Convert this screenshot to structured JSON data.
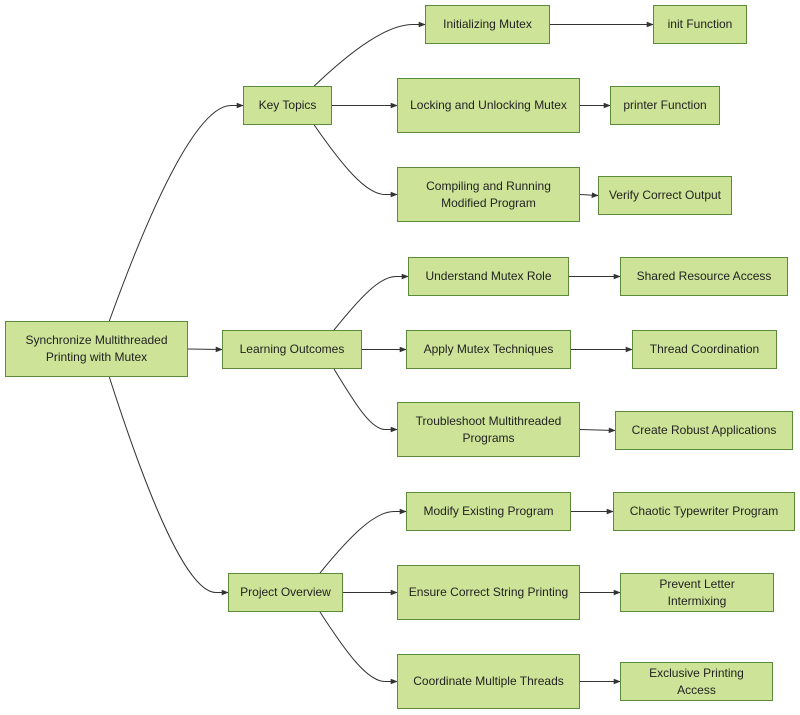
{
  "diagram": {
    "title": "Synchronize Multithreaded Printing with Mutex",
    "colors": {
      "node_fill": "#cde498",
      "node_border": "#5b8a3a",
      "edge": "#333333"
    },
    "nodes": [
      {
        "id": "root",
        "label": "Synchronize Multithreaded Printing with Mutex"
      },
      {
        "id": "kt",
        "label": "Key Topics"
      },
      {
        "id": "lo",
        "label": "Learning Outcomes"
      },
      {
        "id": "po",
        "label": "Project Overview"
      },
      {
        "id": "kt1",
        "label": "Initializing Mutex"
      },
      {
        "id": "kt2",
        "label": "Locking and Unlocking Mutex"
      },
      {
        "id": "kt3",
        "label": "Compiling and Running Modified Program"
      },
      {
        "id": "kt1a",
        "label": "init Function"
      },
      {
        "id": "kt2a",
        "label": "printer Function"
      },
      {
        "id": "kt3a",
        "label": "Verify Correct Output"
      },
      {
        "id": "lo1",
        "label": "Understand Mutex Role"
      },
      {
        "id": "lo2",
        "label": "Apply Mutex Techniques"
      },
      {
        "id": "lo3",
        "label": "Troubleshoot Multithreaded Programs"
      },
      {
        "id": "lo1a",
        "label": "Shared Resource Access"
      },
      {
        "id": "lo2a",
        "label": "Thread Coordination"
      },
      {
        "id": "lo3a",
        "label": "Create Robust Applications"
      },
      {
        "id": "po1",
        "label": "Modify Existing Program"
      },
      {
        "id": "po2",
        "label": "Ensure Correct String Printing"
      },
      {
        "id": "po3",
        "label": "Coordinate Multiple Threads"
      },
      {
        "id": "po1a",
        "label": "Chaotic Typewriter Program"
      },
      {
        "id": "po2a",
        "label": "Prevent Letter Intermixing"
      },
      {
        "id": "po3a",
        "label": "Exclusive Printing Access"
      }
    ],
    "edges": [
      [
        "root",
        "kt"
      ],
      [
        "root",
        "lo"
      ],
      [
        "root",
        "po"
      ],
      [
        "kt",
        "kt1"
      ],
      [
        "kt",
        "kt2"
      ],
      [
        "kt",
        "kt3"
      ],
      [
        "kt1",
        "kt1a"
      ],
      [
        "kt2",
        "kt2a"
      ],
      [
        "kt3",
        "kt3a"
      ],
      [
        "lo",
        "lo1"
      ],
      [
        "lo",
        "lo2"
      ],
      [
        "lo",
        "lo3"
      ],
      [
        "lo1",
        "lo1a"
      ],
      [
        "lo2",
        "lo2a"
      ],
      [
        "lo3",
        "lo3a"
      ],
      [
        "po",
        "po1"
      ],
      [
        "po",
        "po2"
      ],
      [
        "po",
        "po3"
      ],
      [
        "po1",
        "po1a"
      ],
      [
        "po2",
        "po2a"
      ],
      [
        "po3",
        "po3a"
      ]
    ]
  }
}
